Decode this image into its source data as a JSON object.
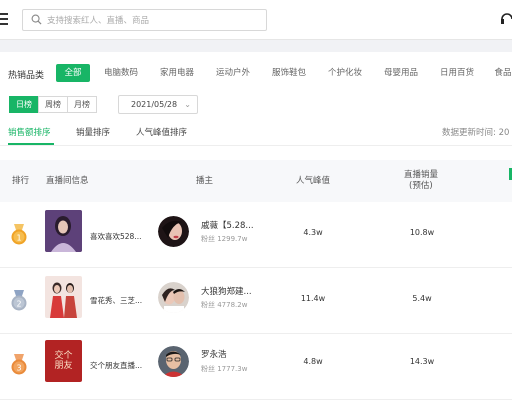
{
  "search": {
    "placeholder": "支持搜索红人、直播、商品"
  },
  "categories": {
    "title": "热销品类",
    "items": [
      {
        "label": "全部",
        "active": true
      },
      {
        "label": "电脑数码",
        "active": false
      },
      {
        "label": "家用电器",
        "active": false
      },
      {
        "label": "运动户外",
        "active": false
      },
      {
        "label": "服饰鞋包",
        "active": false
      },
      {
        "label": "个护化妆",
        "active": false
      },
      {
        "label": "母婴用品",
        "active": false
      },
      {
        "label": "日用百货",
        "active": false
      },
      {
        "label": "食品",
        "active": false
      }
    ]
  },
  "period": {
    "day": "日榜",
    "week": "周榜",
    "month": "月榜",
    "selected": "日榜"
  },
  "date": {
    "value": "2021/05/28"
  },
  "sort_tabs": {
    "sales_amount": "销售额排序",
    "sales_volume": "销量排序",
    "peak_popularity": "人气峰值排序"
  },
  "update_time_label": "数据更新时间: 20",
  "table": {
    "headers": {
      "rank": "排行",
      "live_info": "直播间信息",
      "anchor": "播主",
      "peak": "人气峰值",
      "sales_line1": "直播销量",
      "sales_line2": "(预估)"
    },
    "rows": [
      {
        "rank": "1",
        "live_title": "喜欢喜欢528...",
        "anchor_name": "戚薇【5.28...",
        "fans": "粉丝 1299.7w",
        "peak": "4.3w",
        "sales": "10.8w"
      },
      {
        "rank": "2",
        "live_title": "雪花秀、三芝...",
        "anchor_name": "大狼狗郑建...",
        "fans": "粉丝 4778.2w",
        "peak": "11.4w",
        "sales": "5.4w"
      },
      {
        "rank": "3",
        "live_title": "交个朋友直播...",
        "anchor_name": "罗永浩",
        "fans": "粉丝 1777.3w",
        "peak": "4.8w",
        "sales": "14.3w"
      }
    ]
  },
  "thumb3_text": "交个朋友",
  "colors": {
    "accent": "#18b566",
    "gold": "#f0a326",
    "silver": "#a8b3c4",
    "bronze": "#e98a3a"
  },
  "icons": {
    "menu": "menu-icon",
    "search": "search-icon",
    "headset": "headset-icon",
    "medal": "medal-icon"
  }
}
